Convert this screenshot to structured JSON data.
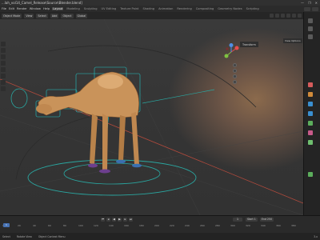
{
  "window": {
    "title": "...lah_vol14_Camel_Release\\Source\\Blender.blend]",
    "controls": [
      "—",
      "❐",
      "✕"
    ]
  },
  "menubar": {
    "items": [
      "File",
      "Edit",
      "Render",
      "Window",
      "Help"
    ],
    "tabs": [
      "Layout",
      "Modeling",
      "Sculpting",
      "UV Editing",
      "Texture Paint",
      "Shading",
      "Animation",
      "Rendering",
      "Compositing",
      "Geometry Nodes",
      "Scripting"
    ],
    "active_tab": "Layout"
  },
  "viewport_header": {
    "mode": "Object Mode",
    "menus": [
      "View",
      "Select",
      "Add",
      "Object"
    ],
    "orientation": "Global",
    "view_options": "View Options"
  },
  "viewport": {
    "side_tab": "Transform",
    "gizmo_axes": {
      "x_color": "#e84d4d",
      "y_color": "#7fc241",
      "z_color": "#4f8fe6"
    }
  },
  "timeline": {
    "current_frame": "1",
    "playhead": "1",
    "start_label": "Start 1",
    "end_label": "End 250",
    "ruler": [
      "0",
      "20",
      "40",
      "60",
      "80",
      "100",
      "120",
      "140",
      "160",
      "180",
      "200",
      "220",
      "240",
      "260",
      "280",
      "300",
      "320",
      "340",
      "360",
      "380"
    ]
  },
  "statusbar": {
    "select": "Select",
    "rotate": "Rotate View",
    "menu": "Object Context Menu",
    "version": "3.x"
  },
  "colors": {
    "accent": "#4772b3",
    "rig_cyan": "#22c3c3",
    "circle_teal": "#2aa6a0",
    "red_line": "#b44a3c",
    "camel_tan": "#c9935a"
  }
}
